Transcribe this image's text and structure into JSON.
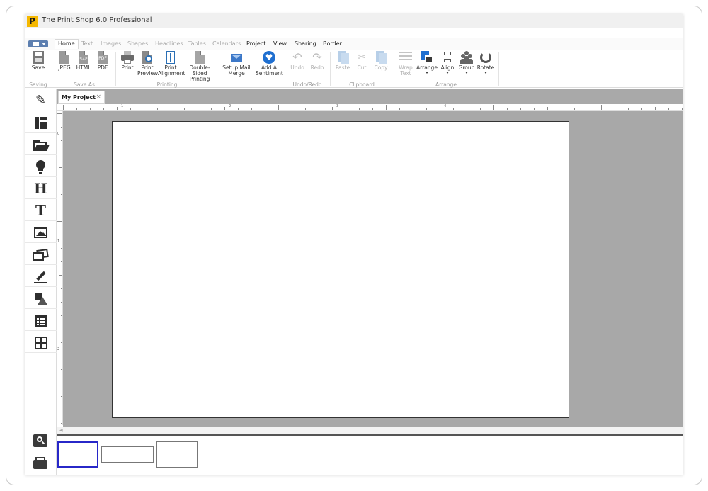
{
  "app": {
    "logo_letter": "P",
    "title": "The Print Shop 6.0 Professional",
    "accent_color": "#f5b800"
  },
  "tabs": [
    {
      "label": "Home",
      "state": "active"
    },
    {
      "label": "Text",
      "state": "disabled"
    },
    {
      "label": "Images",
      "state": "disabled"
    },
    {
      "label": "Shapes",
      "state": "disabled"
    },
    {
      "label": "Headlines",
      "state": "disabled"
    },
    {
      "label": "Tables",
      "state": "disabled"
    },
    {
      "label": "Calendars",
      "state": "disabled"
    },
    {
      "label": "Project",
      "state": "enabled"
    },
    {
      "label": "View",
      "state": "enabled"
    },
    {
      "label": "Sharing",
      "state": "enabled"
    },
    {
      "label": "Border",
      "state": "enabled"
    }
  ],
  "ribbon": {
    "save": {
      "label": "Save",
      "icon": "save-icon"
    },
    "jpeg": {
      "label": "JPEG",
      "icon": "jpeg-file-icon"
    },
    "html": {
      "label": "HTML",
      "icon": "html-file-icon",
      "glyph": "</>"
    },
    "pdf": {
      "label": "PDF",
      "icon": "pdf-file-icon",
      "glyph": "PDF"
    },
    "print": {
      "label": "Print",
      "icon": "printer-icon"
    },
    "print_preview": {
      "label1": "Print",
      "label2": "Preview",
      "icon": "print-preview-icon"
    },
    "print_alignment": {
      "label1": "Print",
      "label2": "Alignment",
      "icon": "print-alignment-icon"
    },
    "double_sided": {
      "label1": "Double-Sided",
      "label2": "Printing",
      "icon": "double-sided-icon"
    },
    "mail_merge": {
      "label1": "Setup Mail",
      "label2": "Merge",
      "icon": "mail-icon"
    },
    "sentiment": {
      "label1": "Add A",
      "label2": "Sentiment",
      "icon": "heart-icon"
    },
    "undo": {
      "label": "Undo",
      "icon": "undo-icon",
      "glyph": "↶"
    },
    "redo": {
      "label": "Redo",
      "icon": "redo-icon",
      "glyph": "↷"
    },
    "paste": {
      "label": "Paste",
      "icon": "paste-icon"
    },
    "cut": {
      "label": "Cut",
      "icon": "scissors-icon",
      "glyph": "✂"
    },
    "copy": {
      "label": "Copy",
      "icon": "copy-icon"
    },
    "wrap_text": {
      "label1": "Wrap",
      "label2": "Text",
      "icon": "wrap-text-icon"
    },
    "arrange": {
      "label": "Arrange",
      "icon": "arrange-icon"
    },
    "align": {
      "label": "Align",
      "icon": "align-icon"
    },
    "group": {
      "label": "Group",
      "icon": "group-icon"
    },
    "rotate": {
      "label": "Rotate",
      "icon": "rotate-icon"
    },
    "groups": {
      "saving": "Saving",
      "save_as": "Save As",
      "printing": "Printing",
      "undo_redo": "Undo/Redo",
      "clipboard": "Clipboard",
      "arrange": "Arrange"
    }
  },
  "left_tools": [
    {
      "name": "pencil-tool",
      "glyph": "✎"
    },
    {
      "name": "layout-tool",
      "glyph": ""
    },
    {
      "name": "open-folder-tool",
      "glyph": ""
    },
    {
      "name": "lightbulb-tool",
      "glyph": ""
    },
    {
      "name": "headline-tool",
      "glyph": "H"
    },
    {
      "name": "text-tool",
      "glyph": "T"
    },
    {
      "name": "image-tool",
      "glyph": ""
    },
    {
      "name": "photos-tool",
      "glyph": ""
    },
    {
      "name": "draw-tool",
      "glyph": ""
    },
    {
      "name": "shapes-tool",
      "glyph": ""
    },
    {
      "name": "calendar-tool",
      "glyph": ""
    },
    {
      "name": "table-tool",
      "glyph": ""
    }
  ],
  "document": {
    "tab_label": "My Project",
    "close_glyph": "×"
  },
  "ruler": {
    "top_labels": [
      "1",
      "2",
      "3",
      "4"
    ],
    "left_labels": [
      "0",
      "1",
      "2"
    ]
  },
  "colors": {
    "canvas_bg": "#a8a8a8",
    "selected_thumb": "#2727c8",
    "brand_blue": "#1f6fd0"
  }
}
